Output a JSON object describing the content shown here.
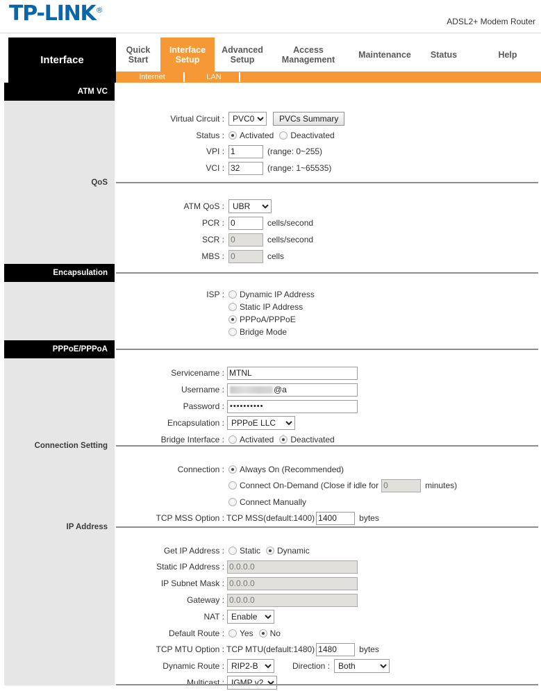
{
  "brand": {
    "name": "TP-LINK",
    "registered": "®",
    "color": "#0a66aa",
    "model": "ADSL2+ Modem Router"
  },
  "panel": {
    "title": "Interface"
  },
  "nav": {
    "accent": "#f79836",
    "items": [
      {
        "label1": "Quick",
        "label2": "Start",
        "active": false
      },
      {
        "label1": "Interface",
        "label2": "Setup",
        "active": true
      },
      {
        "label1": "Advanced",
        "label2": "Setup",
        "active": false
      },
      {
        "label1": "Access",
        "label2": "Management",
        "active": false
      },
      {
        "label1": "Maintenance",
        "label2": "",
        "active": false
      },
      {
        "label1": "Status",
        "label2": "",
        "active": false
      },
      {
        "label1": "Help",
        "label2": "",
        "active": false
      }
    ],
    "subitems": [
      {
        "label": "Internet",
        "active": true
      },
      {
        "label": "LAN",
        "active": false
      }
    ]
  },
  "sections": {
    "atm_vc": {
      "title": "ATM VC",
      "virtual_circuit_label": "Virtual Circuit :",
      "virtual_circuit_value": "PVC0",
      "pvcs_summary_button": "PVCs Summary",
      "status_label": "Status :",
      "status_activated": "Activated",
      "status_deactivated": "Deactivated",
      "status_selected": "Activated",
      "vpi_label": "VPI :",
      "vpi_value": "1",
      "vpi_hint": "(range: 0~255)",
      "vci_label": "VCI :",
      "vci_value": "32",
      "vci_hint": "(range: 1~65535)"
    },
    "qos": {
      "title": "QoS",
      "atm_qos_label": "ATM QoS :",
      "atm_qos_value": "UBR",
      "pcr_label": "PCR :",
      "pcr_value": "0",
      "pcr_unit": "cells/second",
      "scr_label": "SCR :",
      "scr_value": "0",
      "scr_unit": "cells/second",
      "mbs_label": "MBS :",
      "mbs_value": "0",
      "mbs_unit": "cells"
    },
    "encapsulation": {
      "title": "Encapsulation",
      "isp_label": "ISP :",
      "isp_options": [
        "Dynamic IP Address",
        "Static IP Address",
        "PPPoA/PPPoE",
        "Bridge Mode"
      ],
      "isp_selected": "PPPoA/PPPoE"
    },
    "pppoe": {
      "title": "PPPoE/PPPoA",
      "servicename_label": "Servicename :",
      "servicename_value": "MTNL",
      "username_label": "Username :",
      "username_value": "@a",
      "password_label": "Password :",
      "password_value": "••••••••••",
      "encapsulation_label": "Encapsulation :",
      "encapsulation_value": "PPPoE LLC",
      "bridge_interface_label": "Bridge Interface :",
      "bridge_activated": "Activated",
      "bridge_deactivated": "Deactivated",
      "bridge_selected": "Deactivated"
    },
    "connection_setting": {
      "title": "Connection Setting",
      "connection_label": "Connection :",
      "always_on": "Always On (Recommended)",
      "on_demand_pre": "Connect On-Demand (Close if idle for",
      "on_demand_idle_value": "0",
      "on_demand_post": "minutes)",
      "connect_manually": "Connect Manually",
      "connection_selected": "Always On (Recommended)",
      "tcp_mss_label": "TCP MSS Option :",
      "tcp_mss_prefix": "TCP MSS(default:1400)",
      "tcp_mss_value": "1400",
      "tcp_mss_unit": "bytes"
    },
    "ip_address": {
      "title": "IP Address",
      "get_ip_label": "Get IP Address :",
      "get_ip_static": "Static",
      "get_ip_dynamic": "Dynamic",
      "get_ip_selected": "Dynamic",
      "static_ip_label": "Static IP Address :",
      "static_ip_value": "0.0.0.0",
      "subnet_label": "IP Subnet Mask :",
      "subnet_value": "0.0.0.0",
      "gateway_label": "Gateway :",
      "gateway_value": "0.0.0.0",
      "nat_label": "NAT :",
      "nat_value": "Enable",
      "default_route_label": "Default Route :",
      "default_route_yes": "Yes",
      "default_route_no": "No",
      "default_route_selected": "No",
      "tcp_mtu_label": "TCP MTU Option :",
      "tcp_mtu_prefix": "TCP MTU(default:1480)",
      "tcp_mtu_value": "1480",
      "tcp_mtu_unit": "bytes",
      "dynamic_route_label": "Dynamic Route :",
      "dynamic_route_value": "RIP2-B",
      "direction_label": "Direction :",
      "direction_value": "Both",
      "multicast_label": "Multicast :",
      "multicast_value": "IGMP v2"
    }
  }
}
